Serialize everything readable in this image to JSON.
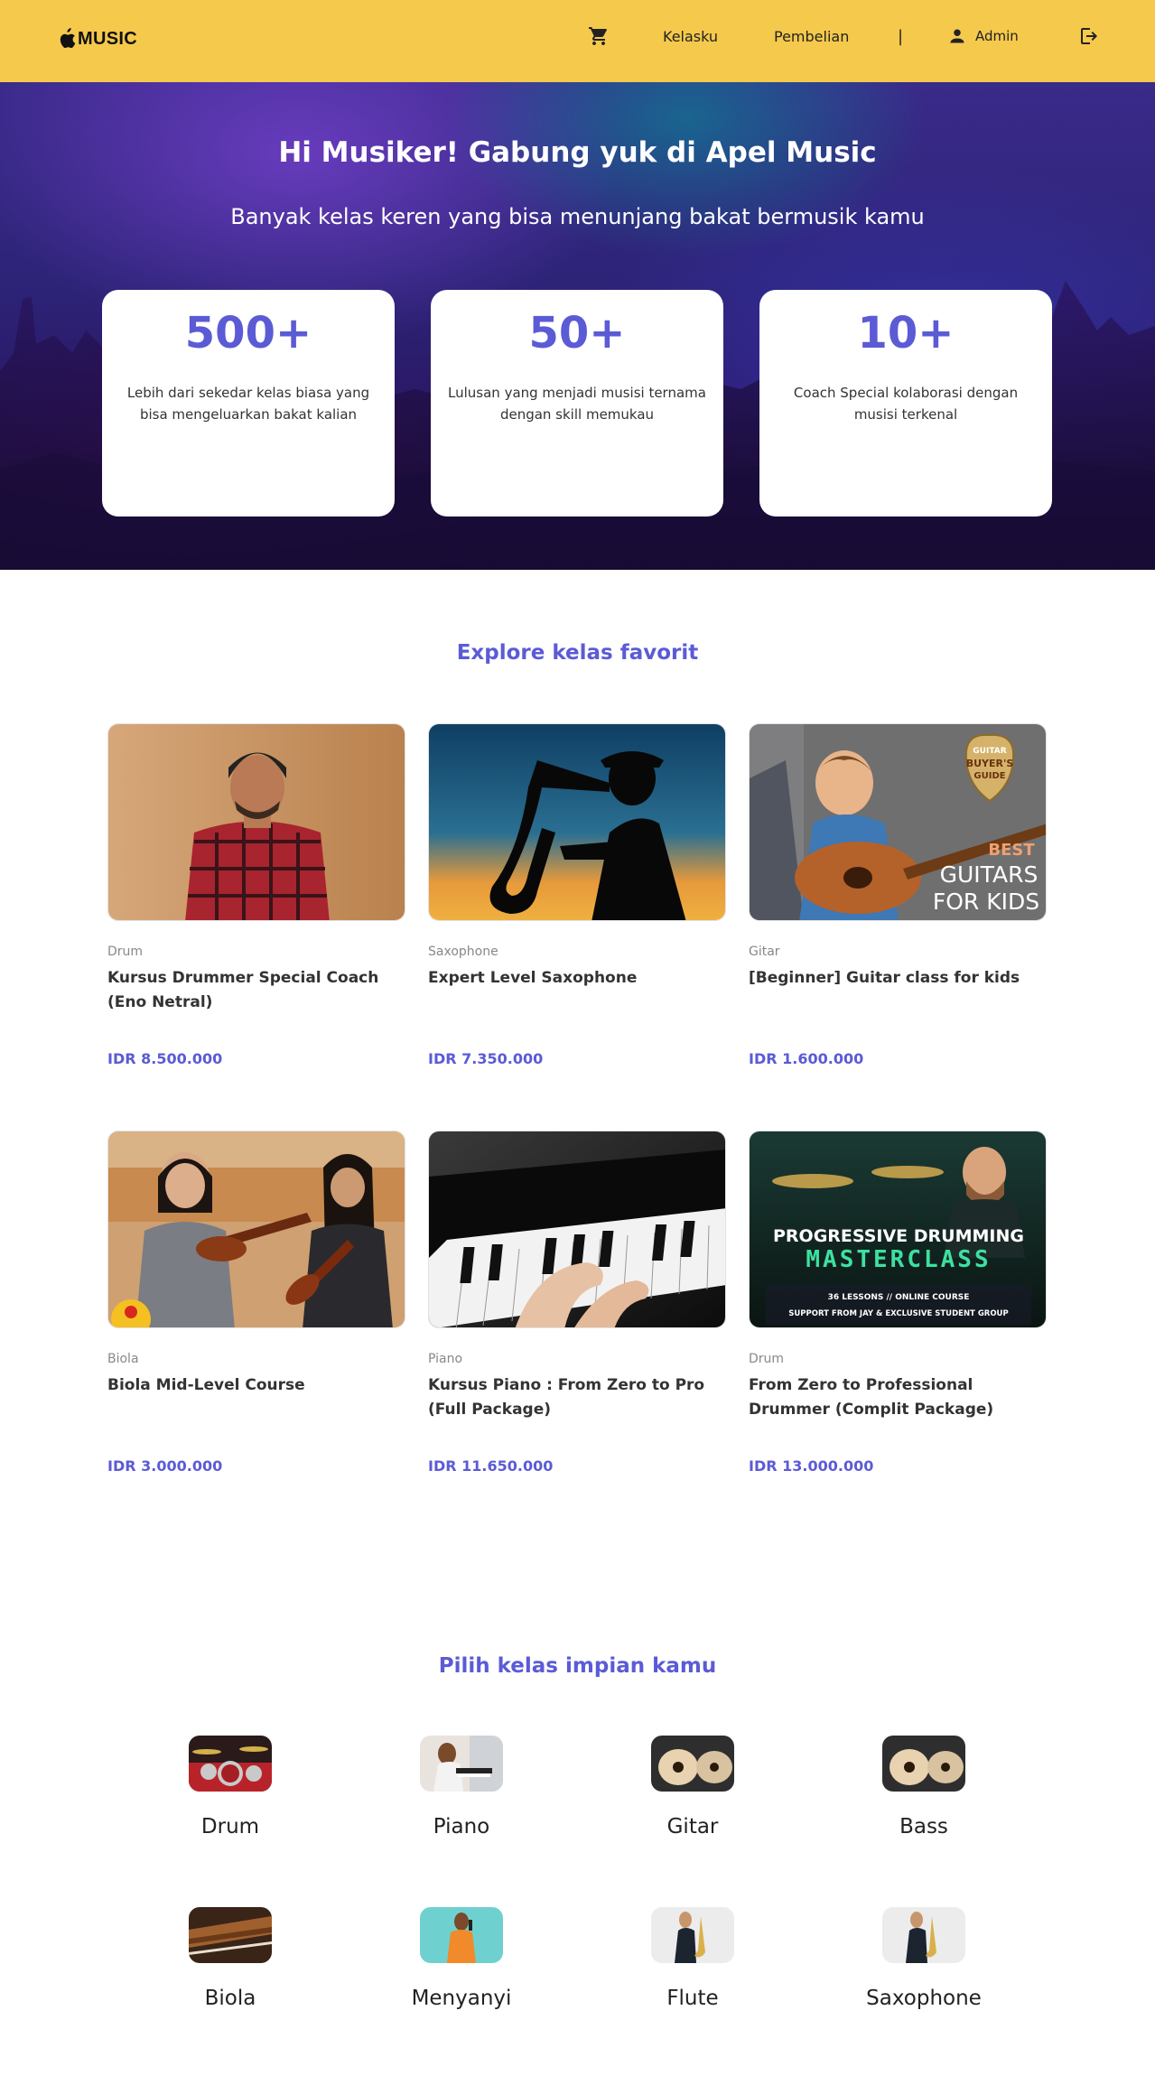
{
  "navbar": {
    "logo_text": "MUSIC",
    "links": {
      "kelasku": "Kelasku",
      "pembelian": "Pembelian"
    },
    "separator": "|",
    "user_label": "Admin"
  },
  "hero": {
    "title": "Hi Musiker! Gabung yuk di Apel Music",
    "subtitle": "Banyak kelas keren yang bisa menunjang bakat bermusik kamu",
    "stats": [
      {
        "value": "500+",
        "desc": "Lebih dari sekedar kelas biasa yang bisa mengeluarkan bakat kalian"
      },
      {
        "value": "50+",
        "desc": "Lulusan yang menjadi musisi ternama dengan skill memukau"
      },
      {
        "value": "10+",
        "desc": "Coach Special kolaborasi dengan musisi terkenal"
      }
    ]
  },
  "explore": {
    "title": "Explore kelas favorit",
    "courses": [
      {
        "category": "Drum",
        "name": "Kursus Drummer Special Coach (Eno Netral)",
        "price": "IDR 8.500.000"
      },
      {
        "category": "Saxophone",
        "name": "Expert Level Saxophone",
        "price": "IDR 7.350.000"
      },
      {
        "category": "Gitar",
        "name": "[Beginner] Guitar class for kids",
        "price": "IDR 1.600.000",
        "image_text": {
          "badge_top": "GUITAR",
          "badge_mid": "BUYER'S",
          "badge_bottom": "GUIDE",
          "line1": "BEST",
          "line2": "GUITARS",
          "line3": "FOR KIDS"
        }
      },
      {
        "category": "Biola",
        "name": "Biola Mid-Level Course",
        "price": "IDR 3.000.000"
      },
      {
        "category": "Piano",
        "name": "Kursus Piano : From Zero to Pro (Full Package)",
        "price": "IDR 11.650.000"
      },
      {
        "category": "Drum",
        "name": "From Zero to Professional Drummer (Complit Package)",
        "price": "IDR 13.000.000",
        "image_text": {
          "line1": "PROGRESSIVE DRUMMING",
          "line2": "MASTERCLASS",
          "line3": "36 LESSONS // ONLINE COURSE",
          "line4": "SUPPORT FROM JAY & EXCLUSIVE STUDENT GROUP"
        }
      }
    ]
  },
  "categories": {
    "title": "Pilih kelas impian kamu",
    "items": [
      {
        "label": "Drum"
      },
      {
        "label": "Piano"
      },
      {
        "label": "Gitar"
      },
      {
        "label": "Bass"
      },
      {
        "label": "Biola"
      },
      {
        "label": "Menyanyi"
      },
      {
        "label": "Flute"
      },
      {
        "label": "Saxophone"
      }
    ]
  },
  "colors": {
    "navbar": "#f5c94c",
    "accent": "#5b5bd6",
    "text": "#333333"
  }
}
